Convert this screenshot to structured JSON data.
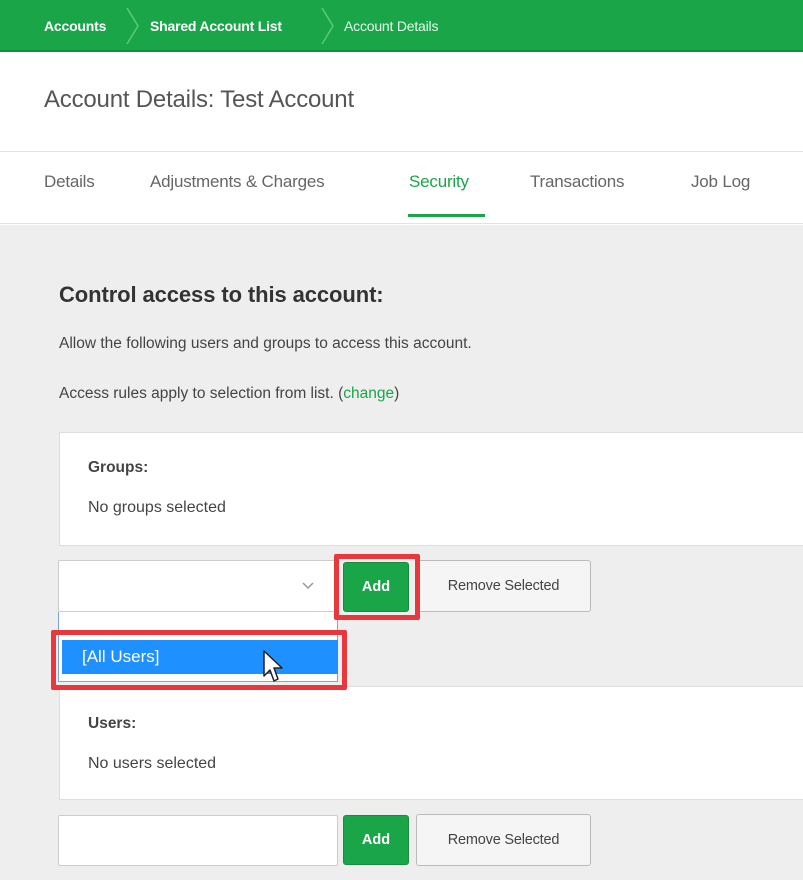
{
  "breadcrumb": {
    "items": [
      "Accounts",
      "Shared Account List",
      "Account Details"
    ]
  },
  "header": {
    "title": "Account Details: Test Account"
  },
  "tabs": [
    {
      "label": "Details",
      "active": false
    },
    {
      "label": "Adjustments & Charges",
      "active": false
    },
    {
      "label": "Security",
      "active": true
    },
    {
      "label": "Transactions",
      "active": false
    },
    {
      "label": "Job Log",
      "active": false
    }
  ],
  "security": {
    "title": "Control access to this account:",
    "description": "Allow the following users and groups to access this account.",
    "rules_text": "Access rules apply to selection from list. (",
    "rules_link": "change",
    "rules_close": ")"
  },
  "groups": {
    "label": "Groups:",
    "empty_text": "No groups selected",
    "select_value": "",
    "add_label": "Add",
    "remove_label": "Remove Selected",
    "dropdown_options": [
      "[All Users]"
    ]
  },
  "users": {
    "label": "Users:",
    "empty_text": "No users selected",
    "input_value": "",
    "add_label": "Add",
    "remove_label": "Remove Selected"
  },
  "colors": {
    "accent": "#1aa648",
    "highlight": "#e8373d",
    "selection": "#1e90ff",
    "content_bg": "#eeeeee"
  },
  "icons": {
    "breadcrumb_separator": "chevron-right-icon",
    "select_chevron": "chevron-down-icon",
    "cursor": "mouse-pointer-icon"
  }
}
